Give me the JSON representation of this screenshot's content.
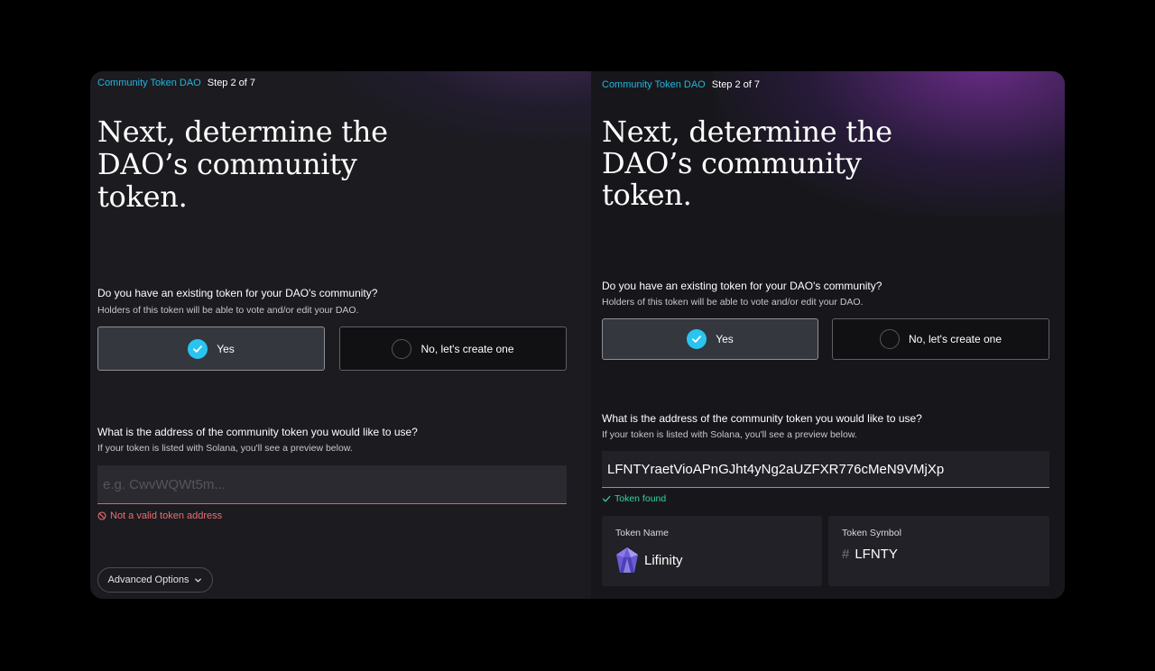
{
  "left": {
    "breadcrumb": {
      "dao": "Community Token DAO",
      "step": "Step 2 of 7"
    },
    "title": [
      "Next, determine the",
      "DAO’s community",
      "token."
    ],
    "existing_question": "Do you have an existing token for your DAO's community?",
    "existing_sub": "Holders of this token will be able to vote and/or edit your DAO.",
    "option_yes": "Yes",
    "option_no": "No, let's create one",
    "address_question": "What is the address of the community token you would like to use?",
    "address_sub": "If your token is listed with Solana, you'll see a preview below.",
    "address_placeholder": "e.g. CwvWQWt5m...",
    "address_value": "",
    "error": "Not a valid token address",
    "advanced": "Advanced Options"
  },
  "right": {
    "breadcrumb": {
      "dao": "Community Token DAO",
      "step": "Step 2 of 7"
    },
    "title": [
      "Next, determine the",
      "DAO’s community",
      "token."
    ],
    "existing_question": "Do you have an existing token for your DAO's community?",
    "existing_sub": "Holders of this token will be able to vote and/or edit your DAO.",
    "option_yes": "Yes",
    "option_no": "No, let's create one",
    "address_question": "What is the address of the community token you would like to use?",
    "address_sub": "If your token is listed with Solana, you'll see a preview below.",
    "address_value": "LFNTYraetVioAPnGJht4yNg2aUZFXR776cMeN9VMjXp",
    "found": "Token found",
    "token_name_label": "Token Name",
    "token_name": "Lifinity",
    "token_symbol_label": "Token Symbol",
    "token_symbol_prefix": "#",
    "token_symbol": "LFNTY"
  },
  "colors": {
    "accent": "#29c4ef",
    "breadcrumb": "#22b5e0",
    "error": "#ea6d73",
    "success": "#35d0a0"
  },
  "icons": {
    "selected": "check-circle-icon",
    "unselected": "empty-radio-icon",
    "error": "no-entry-icon",
    "success": "checkmark-icon",
    "advanced": "chevron-down-icon",
    "token": "lifinity-logo-icon"
  }
}
